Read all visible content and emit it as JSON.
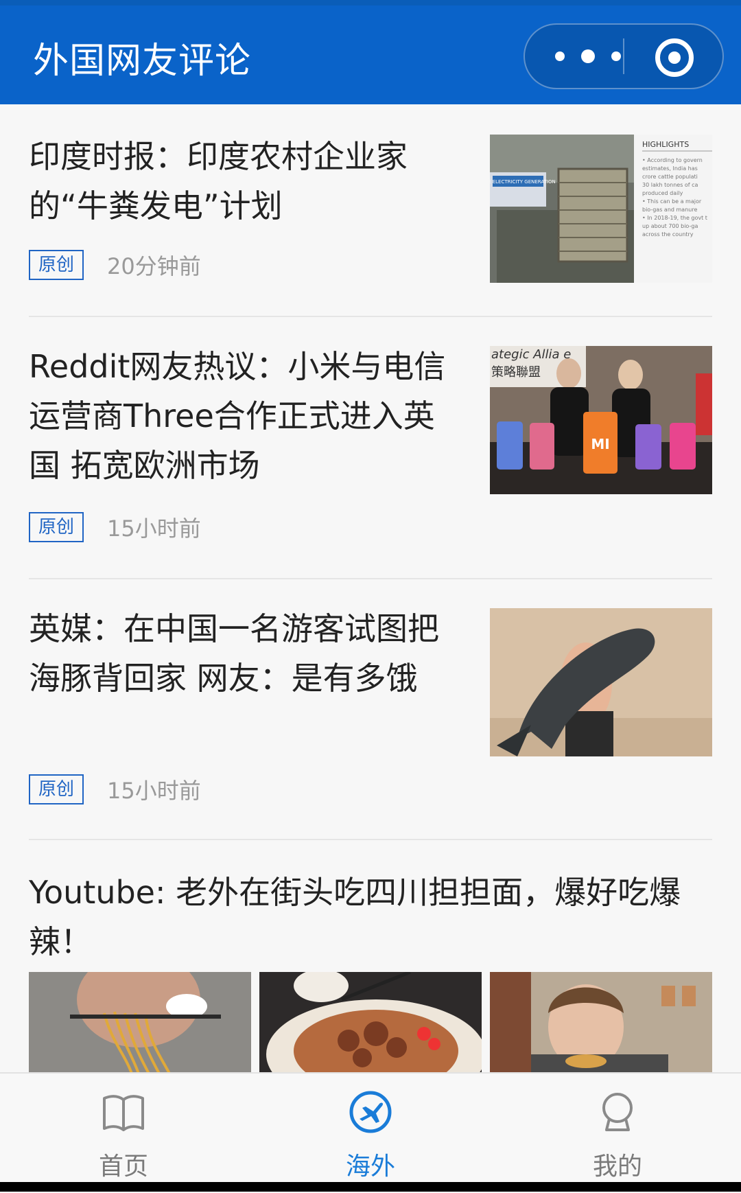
{
  "header": {
    "title": "外国网友评论"
  },
  "articles": [
    {
      "headline": "印度时报：印度农村企业家的“牛粪发电”计划",
      "badge": "原创",
      "time": "20分钟前"
    },
    {
      "headline": "Reddit网友热议：小米与电信运营商Three合作正式进入英国 拓宽欧洲市场",
      "badge": "原创",
      "time": "15小时前"
    },
    {
      "headline": "英媒：在中国一名游客试图把海豚背回家 网友：是有多饿",
      "badge": "原创",
      "time": "15小时前"
    }
  ],
  "article1_thumb": {
    "sidebar_heading": "HIGHLIGHTS",
    "sidebar_lines": [
      "• According to govern",
      "estimates, India has",
      "crore cattle populati",
      "30 lakh tonnes of ca",
      "produced daily",
      "• This can be a major",
      "bio-gas and manure",
      "• In 2018-19, the govt t",
      "up about 700 bio-ga",
      "across the country"
    ],
    "screen_caption": "LIVE ELECTRICITY GENERATION"
  },
  "article2_thumb": {
    "banner_line1": "ategic Allia  e",
    "banner_line2": "策略聯盟",
    "logo": "MI"
  },
  "youtube_post": {
    "title": "Youtube: 老外在街头吃四川担担面，爆好吃爆辣！"
  },
  "tabbar": {
    "tabs": [
      {
        "label": "首页",
        "icon": "book-icon"
      },
      {
        "label": "海外",
        "icon": "plane-icon"
      },
      {
        "label": "我的",
        "icon": "user-icon"
      }
    ],
    "active_index": 1
  },
  "colors": {
    "brand": "#0a63c9",
    "accent": "#1a7cd8",
    "badge": "#1f64c4"
  }
}
